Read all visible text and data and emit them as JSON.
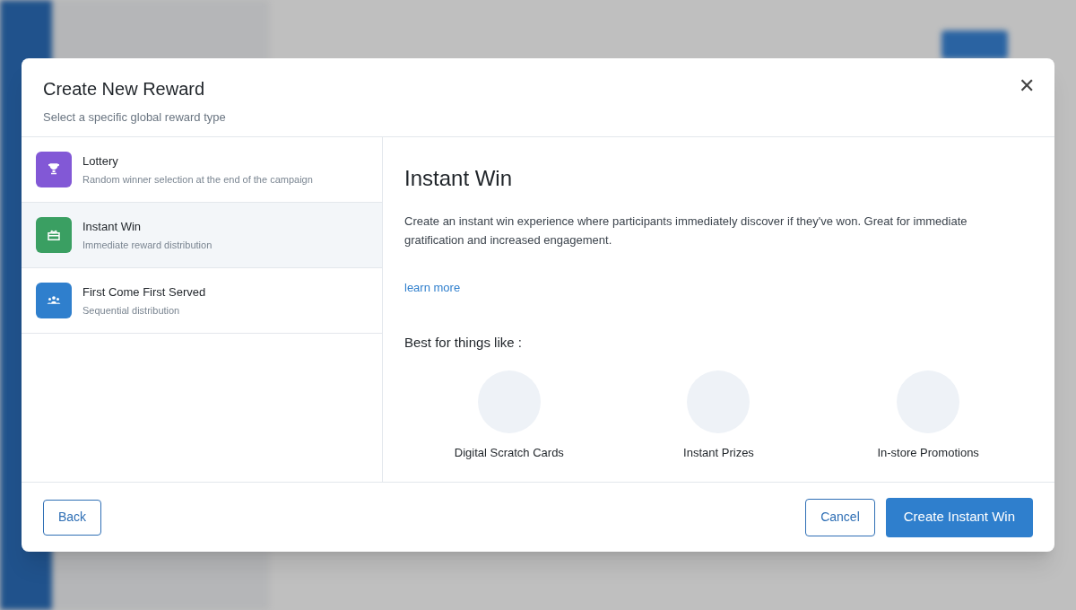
{
  "dialog": {
    "title": "Create New Reward",
    "subtitle": "Select a specific global reward type",
    "close_icon": "✕"
  },
  "reward_types": [
    {
      "kind": "trophy",
      "title": "Lottery",
      "description": "Random winner selection at the end of the campaign",
      "color": "#8258d6",
      "selected": false
    },
    {
      "kind": "gift",
      "title": "Instant Win",
      "description": "Immediate reward distribution",
      "color": "#3a9f62",
      "selected": true
    },
    {
      "kind": "people",
      "title": "First Come First Served",
      "description": "Sequential distribution",
      "color": "#2f7fcd",
      "selected": false
    }
  ],
  "detail": {
    "title": "Instant Win",
    "description": "Create an instant win experience where participants immediately discover if they've won. Great for immediate gratification and increased engagement.",
    "link": "learn more",
    "examples_heading": "Best for things like :",
    "examples": [
      "Digital Scratch Cards",
      "Instant Prizes",
      "In-store Promotions"
    ]
  },
  "footer": {
    "back": "Back",
    "cancel": "Cancel",
    "primary": "Create Instant Win"
  }
}
